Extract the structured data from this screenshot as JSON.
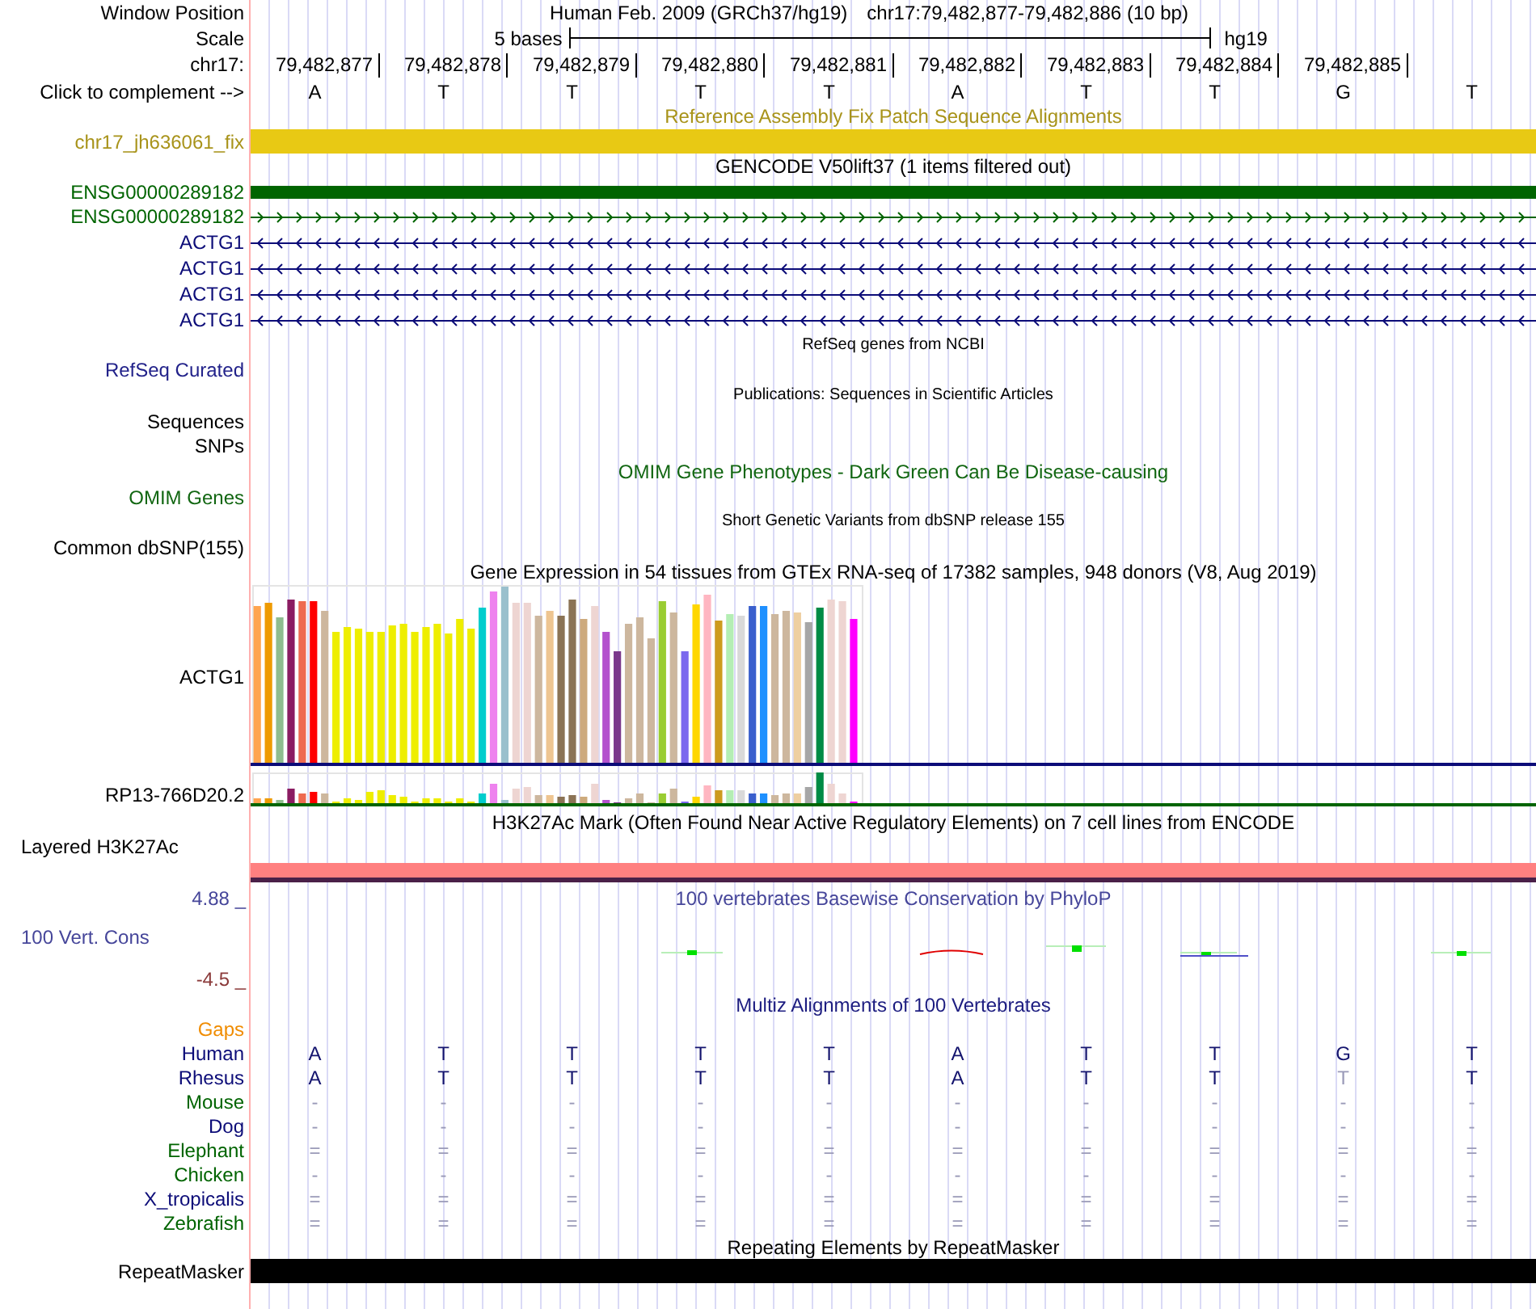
{
  "window_position": {
    "label": "Window Position",
    "assembly": "Human Feb. 2009 (GRCh37/hg19)",
    "range": "chr17:79,482,877-79,482,886 (10 bp)"
  },
  "scale": {
    "label": "Scale",
    "span": "5 bases",
    "assembly": "hg19"
  },
  "ruler": {
    "label": "chr17:",
    "positions": [
      "79,482,877",
      "79,482,878",
      "79,482,879",
      "79,482,880",
      "79,482,881",
      "79,482,882",
      "79,482,883",
      "79,482,884",
      "79,482,885"
    ]
  },
  "complement": {
    "label": "Click to complement -->",
    "bases": [
      "A",
      "T",
      "T",
      "T",
      "T",
      "A",
      "T",
      "T",
      "G",
      "T"
    ]
  },
  "fix_patch_track": {
    "title": "Reference Assembly Fix Patch Sequence Alignments",
    "items": [
      {
        "label": "chr17_jh636061_fix"
      }
    ]
  },
  "gencode_track": {
    "title": "GENCODE V50lift37 (1 items filtered out)",
    "items": [
      {
        "label": "ENSG00000289182",
        "kind": "block",
        "color": "#006400"
      },
      {
        "label": "ENSG00000289182",
        "kind": "line",
        "reverse": false,
        "color": "#006400"
      },
      {
        "label": "ACTG1",
        "kind": "line",
        "reverse": true,
        "color": "#0c0c78"
      },
      {
        "label": "ACTG1",
        "kind": "line",
        "reverse": true,
        "color": "#0c0c78"
      },
      {
        "label": "ACTG1",
        "kind": "line",
        "reverse": true,
        "color": "#0c0c78"
      },
      {
        "label": "ACTG1",
        "kind": "line",
        "reverse": true,
        "color": "#0c0c78"
      }
    ]
  },
  "refseq_track": {
    "title": "RefSeq genes from NCBI",
    "label": "RefSeq Curated"
  },
  "publications_track": {
    "title": "Publications: Sequences in Scientific Articles",
    "labels": [
      "Sequences",
      "SNPs"
    ]
  },
  "omim_track": {
    "title": "OMIM Gene Phenotypes - Dark Green Can Be Disease-causing",
    "label": "OMIM Genes"
  },
  "dbsnp_track": {
    "title": "Short Genetic Variants from dbSNP release 155",
    "label": "Common dbSNP(155)"
  },
  "gtex_track": {
    "title": "Gene Expression in 54 tissues from GTEx RNA-seq of 17382 samples, 948 donors (V8, Aug 2019)",
    "genes": [
      {
        "label": "ACTG1"
      },
      {
        "label": "RP13-766D20.2"
      }
    ]
  },
  "h3k27ac_track": {
    "title": "H3K27Ac Mark (Often Found Near Active Regulatory Elements) on 7 cell lines from ENCODE",
    "label": "Layered H3K27Ac"
  },
  "conservation_track": {
    "title": "100 vertebrates Basewise Conservation by PhyloP",
    "label": "100 Vert. Cons",
    "max_label": "4.88 _",
    "min_label": "-4.5 _"
  },
  "multiz_track": {
    "title": "Multiz Alignments of 100 Vertebrates",
    "gaps_label": "Gaps",
    "species": [
      {
        "name": "Human",
        "color": "#0c0c78",
        "bases": [
          {
            "base": "A",
            "faded": false
          },
          {
            "base": "T",
            "faded": false
          },
          {
            "base": "T",
            "faded": false
          },
          {
            "base": "T",
            "faded": false
          },
          {
            "base": "T",
            "faded": false
          },
          {
            "base": "A",
            "faded": false
          },
          {
            "base": "T",
            "faded": false
          },
          {
            "base": "T",
            "faded": false
          },
          {
            "base": "G",
            "faded": false
          },
          {
            "base": "T",
            "faded": false
          }
        ]
      },
      {
        "name": "Rhesus",
        "color": "#0c0c78",
        "bases": [
          {
            "base": "A",
            "faded": false
          },
          {
            "base": "T",
            "faded": false
          },
          {
            "base": "T",
            "faded": false
          },
          {
            "base": "T",
            "faded": false
          },
          {
            "base": "T",
            "faded": false
          },
          {
            "base": "A",
            "faded": false
          },
          {
            "base": "T",
            "faded": false
          },
          {
            "base": "T",
            "faded": false
          },
          {
            "base": "T",
            "faded": true
          },
          {
            "base": "T",
            "faded": false
          }
        ]
      },
      {
        "name": "Mouse",
        "color": "#006400",
        "bases": [
          {
            "base": "-",
            "faded": true
          },
          {
            "base": "-",
            "faded": true
          },
          {
            "base": "-",
            "faded": true
          },
          {
            "base": "-",
            "faded": true
          },
          {
            "base": "-",
            "faded": true
          },
          {
            "base": "-",
            "faded": true
          },
          {
            "base": "-",
            "faded": true
          },
          {
            "base": "-",
            "faded": true
          },
          {
            "base": "-",
            "faded": true
          },
          {
            "base": "-",
            "faded": true
          }
        ]
      },
      {
        "name": "Dog",
        "color": "#0c0c78",
        "bases": [
          {
            "base": "-",
            "faded": true
          },
          {
            "base": "-",
            "faded": true
          },
          {
            "base": "-",
            "faded": true
          },
          {
            "base": "-",
            "faded": true
          },
          {
            "base": "-",
            "faded": true
          },
          {
            "base": "-",
            "faded": true
          },
          {
            "base": "-",
            "faded": true
          },
          {
            "base": "-",
            "faded": true
          },
          {
            "base": "-",
            "faded": true
          },
          {
            "base": "-",
            "faded": true
          }
        ]
      },
      {
        "name": "Elephant",
        "color": "#006400",
        "bases": [
          {
            "base": "=",
            "faded": true
          },
          {
            "base": "=",
            "faded": true
          },
          {
            "base": "=",
            "faded": true
          },
          {
            "base": "=",
            "faded": true
          },
          {
            "base": "=",
            "faded": true
          },
          {
            "base": "=",
            "faded": true
          },
          {
            "base": "=",
            "faded": true
          },
          {
            "base": "=",
            "faded": true
          },
          {
            "base": "=",
            "faded": true
          },
          {
            "base": "=",
            "faded": true
          }
        ]
      },
      {
        "name": "Chicken",
        "color": "#006400",
        "bases": [
          {
            "base": "-",
            "faded": true
          },
          {
            "base": "-",
            "faded": true
          },
          {
            "base": "-",
            "faded": true
          },
          {
            "base": "-",
            "faded": true
          },
          {
            "base": "-",
            "faded": true
          },
          {
            "base": "-",
            "faded": true
          },
          {
            "base": "-",
            "faded": true
          },
          {
            "base": "-",
            "faded": true
          },
          {
            "base": "-",
            "faded": true
          },
          {
            "base": "-",
            "faded": true
          }
        ]
      },
      {
        "name": "X_tropicalis",
        "color": "#0c0c78",
        "bases": [
          {
            "base": "=",
            "faded": true
          },
          {
            "base": "=",
            "faded": true
          },
          {
            "base": "=",
            "faded": true
          },
          {
            "base": "=",
            "faded": true
          },
          {
            "base": "=",
            "faded": true
          },
          {
            "base": "=",
            "faded": true
          },
          {
            "base": "=",
            "faded": true
          },
          {
            "base": "=",
            "faded": true
          },
          {
            "base": "=",
            "faded": true
          },
          {
            "base": "=",
            "faded": true
          }
        ]
      },
      {
        "name": "Zebrafish",
        "color": "#006400",
        "bases": [
          {
            "base": "=",
            "faded": true
          },
          {
            "base": "=",
            "faded": true
          },
          {
            "base": "=",
            "faded": true
          },
          {
            "base": "=",
            "faded": true
          },
          {
            "base": "=",
            "faded": true
          },
          {
            "base": "=",
            "faded": true
          },
          {
            "base": "=",
            "faded": true
          },
          {
            "base": "=",
            "faded": true
          },
          {
            "base": "=",
            "faded": true
          },
          {
            "base": "=",
            "faded": true
          }
        ]
      }
    ]
  },
  "repeatmasker_track": {
    "title": "Repeating Elements by RepeatMasker",
    "label": "RepeatMasker"
  }
}
